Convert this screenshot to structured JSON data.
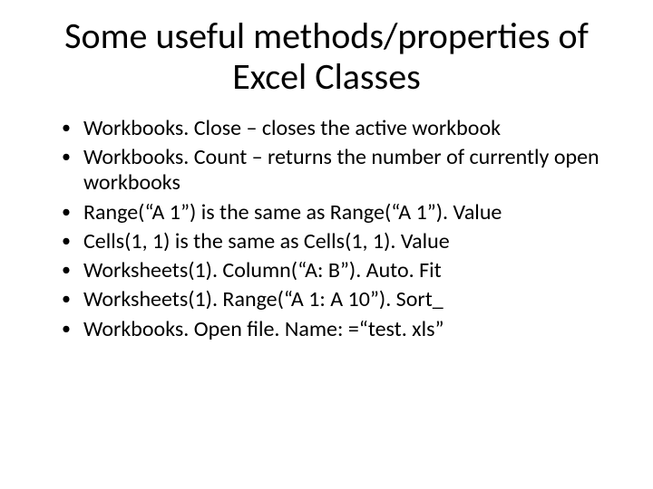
{
  "title": "Some useful methods/properties of Excel Classes",
  "bullets": [
    "Workbooks. Close – closes the active workbook",
    "Workbooks. Count – returns the number of currently open workbooks",
    "Range(“A 1”) is the same as Range(“A 1”). Value",
    "Cells(1, 1) is the same as Cells(1, 1). Value",
    "Worksheets(1). Column(“A: B”). Auto. Fit",
    "Worksheets(1). Range(“A 1: A 10”). Sort_",
    "Workbooks. Open file. Name: =“test. xls”"
  ]
}
